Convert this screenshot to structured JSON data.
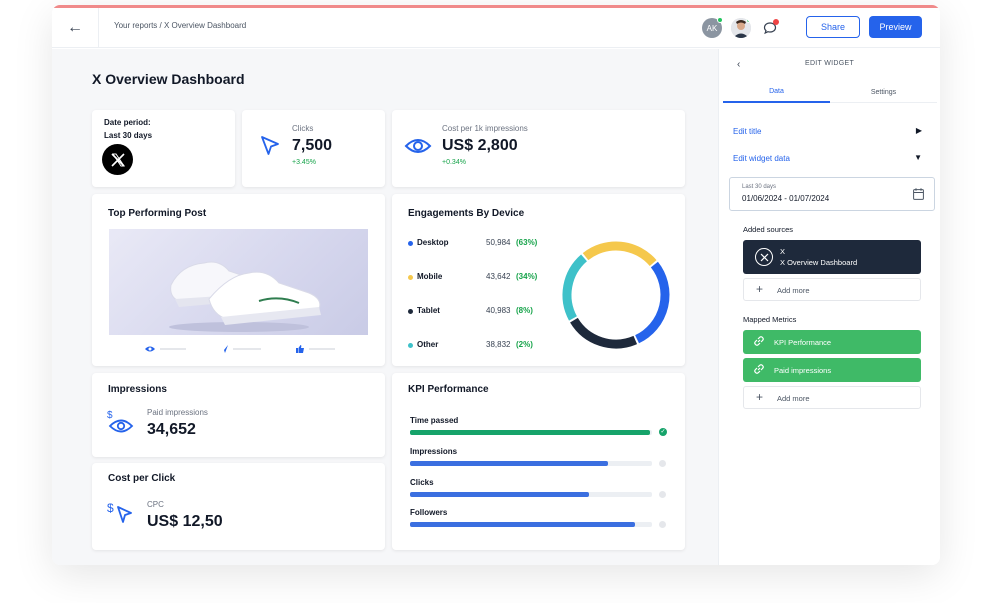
{
  "header": {
    "breadcrumb": "Your reports / X Overview Dashboard",
    "avatar_initials": "AK",
    "share_label": "Share",
    "preview_label": "Preview"
  },
  "page": {
    "title": "X Overview Dashboard"
  },
  "date_card": {
    "label": "Date period:",
    "value": "Last 30 days"
  },
  "clicks_card": {
    "label": "Clicks",
    "value": "7,500",
    "delta": "+3.45%"
  },
  "cpm_card": {
    "label": "Cost per 1k impressions",
    "value": "US$ 2,800",
    "delta": "+0.34%"
  },
  "top_post": {
    "title": "Top Performing Post"
  },
  "engagements": {
    "title": "Engagements By Device",
    "rows": [
      {
        "name": "Desktop",
        "value": "50,984",
        "pct": "(63%)",
        "color": "#2563eb"
      },
      {
        "name": "Mobile",
        "value": "43,642",
        "pct": "(34%)",
        "color": "#f5c84c"
      },
      {
        "name": "Tablet",
        "value": "40,983",
        "pct": "(8%)",
        "color": "#1e293b"
      },
      {
        "name": "Other",
        "value": "38,832",
        "pct": "(2%)",
        "color": "#3ec1c9"
      }
    ]
  },
  "chart_data": {
    "type": "pie",
    "categories": [
      "Desktop",
      "Mobile",
      "Tablet",
      "Other"
    ],
    "values": [
      50984,
      43642,
      40983,
      38832
    ],
    "colors": [
      "#2563eb",
      "#f5c84c",
      "#1e293b",
      "#3ec1c9"
    ]
  },
  "impressions": {
    "title": "Impressions",
    "label": "Paid impressions",
    "value": "34,652"
  },
  "cpc": {
    "title": "Cost per Click",
    "label": "CPC",
    "value": "US$ 12,50"
  },
  "kpi": {
    "title": "KPI Performance",
    "rows": [
      {
        "name": "Time passed",
        "progress": 0.99,
        "color": "#16a36a",
        "done": true
      },
      {
        "name": "Impressions",
        "progress": 0.82,
        "color": "#3b6fe0",
        "done": false
      },
      {
        "name": "Clicks",
        "progress": 0.74,
        "color": "#3b6fe0",
        "done": false
      },
      {
        "name": "Followers",
        "progress": 0.93,
        "color": "#3b6fe0",
        "done": false
      }
    ]
  },
  "sidebar": {
    "title": "EDIT WIDGET",
    "tab_data": "Data",
    "tab_settings": "Settings",
    "edit_title": "Edit title",
    "edit_widget_data": "Edit widget data",
    "date_label": "Last 30 days",
    "date_range": "01/06/2024 - 01/07/2024",
    "added_sources": "Added sources",
    "source_name": "X",
    "source_sub": "X Overview Dashboard",
    "add_more": "Add more",
    "mapped_metrics": "Mapped Metrics",
    "metrics": [
      "KPI Performance",
      "Paid impressions"
    ]
  }
}
